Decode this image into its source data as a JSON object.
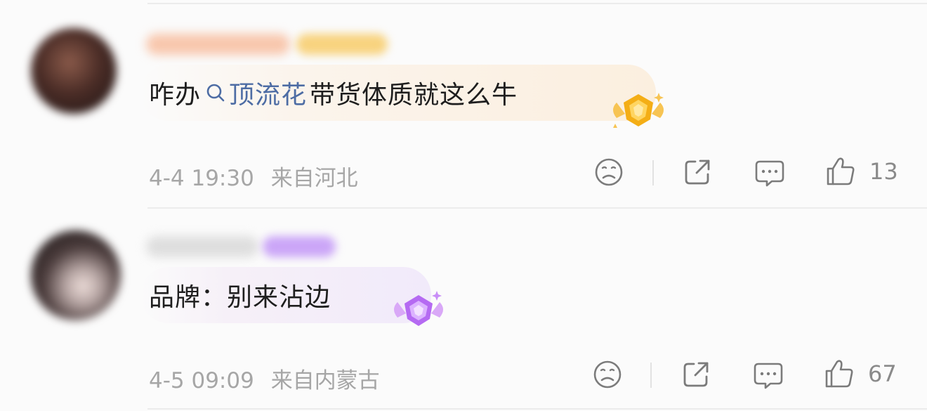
{
  "comments": [
    {
      "body_prefix": "咋办",
      "topic_label": "顶流花",
      "body_suffix": "带货体质就这么牛",
      "time": "4-4 19:30",
      "location": "来自河北",
      "like_count": "13",
      "medal": "gold-medal-icon",
      "medal_color": "#f6b41e"
    },
    {
      "body_prefix": "品牌：别来沾边",
      "topic_label": "",
      "body_suffix": "",
      "time": "4-5 09:09",
      "location": "来自内蒙古",
      "like_count": "67",
      "medal": "purple-medal-icon",
      "medal_color": "#b36bff"
    }
  ],
  "icons": {
    "dislike": "sad-face-icon",
    "share": "share-icon",
    "comment": "comment-icon",
    "like": "thumbs-up-icon",
    "topic": "search-icon"
  }
}
